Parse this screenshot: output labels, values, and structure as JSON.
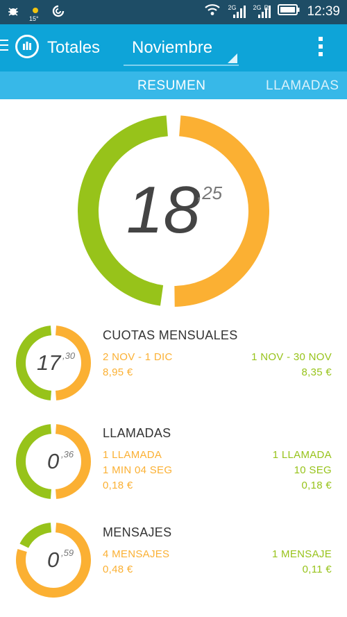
{
  "status_bar": {
    "time": "12:39",
    "temperature": "15°",
    "network_1": "2G",
    "network_2": "2G",
    "network_2_sub": "R",
    "icons": [
      "debug-bug-icon",
      "weather-sun-icon",
      "sync-icon",
      "wifi-icon",
      "signal-icon",
      "signal-icon",
      "battery-icon"
    ]
  },
  "app_bar": {
    "title": "Totales",
    "month": "Noviembre",
    "icons": [
      "menu-lines-icon",
      "app-logo-icon",
      "overflow-menu-icon"
    ]
  },
  "tabs": [
    "RESUMEN",
    "LLAMADAS"
  ],
  "colors": {
    "green": "#97c31a",
    "orange": "#fbb033",
    "appbar": "#0ea4d8",
    "tabs": "#37b8e8",
    "statusbar": "#1e4d66"
  },
  "total": {
    "int": "18",
    "dec": ",25",
    "green_fraction": 0.49
  },
  "sections": [
    {
      "title": "CUOTAS MENSUALES",
      "value_int": "17",
      "value_dec": ",30",
      "green_fraction": 0.5,
      "orange_lines": [
        "2 NOV - 1 DIC",
        "8,95 €"
      ],
      "green_lines": [
        "1 NOV - 30 NOV",
        "8,35 €"
      ]
    },
    {
      "title": "LLAMADAS",
      "value_int": "0",
      "value_dec": ",36",
      "green_fraction": 0.5,
      "orange_lines": [
        "1 LLAMADA",
        "1 MIN 04 SEG",
        "0,18 €"
      ],
      "green_lines": [
        "1 LLAMADA",
        "10 SEG",
        "0,18 €"
      ]
    },
    {
      "title": "MENSAJES",
      "value_int": "0",
      "value_dec": ",59",
      "green_fraction": 0.19,
      "orange_lines": [
        "4 MENSAJES",
        "0,48 €"
      ],
      "green_lines": [
        "1 MENSAJE",
        "0,11 €"
      ]
    }
  ]
}
